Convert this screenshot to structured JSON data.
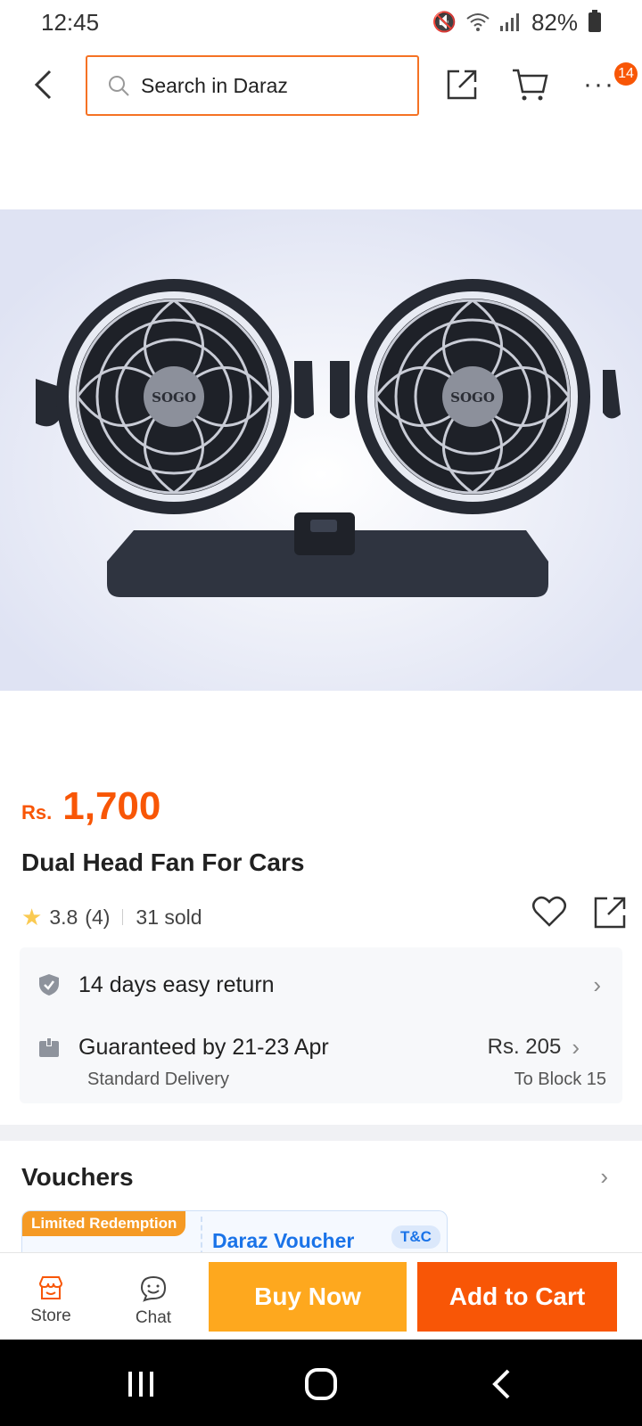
{
  "status_bar": {
    "time": "12:45",
    "battery": "82%"
  },
  "header": {
    "search_placeholder": "Search in Daraz",
    "cart_badge": "14",
    "more_label": "···"
  },
  "product": {
    "brand_on_fan": "SOGO",
    "currency": "Rs.",
    "price": "1,700",
    "title": "Dual Head Fan For Cars",
    "rating": "3.8",
    "review_count": "(4)",
    "sold": "31 sold"
  },
  "services": {
    "return_text": "14 days easy return",
    "delivery_text": "Guaranteed by 21-23 Apr",
    "delivery_type": "Standard Delivery",
    "delivery_fee": "Rs. 205",
    "delivery_location": "To Block 15"
  },
  "vouchers": {
    "title": "Vouchers",
    "tag": "Limited Redemption",
    "voucher_name": "Daraz Voucher",
    "tc_label": "T&C"
  },
  "bottom_bar": {
    "store_label": "Store",
    "chat_label": "Chat",
    "buy_now_label": "Buy Now",
    "add_to_cart_label": "Add to Cart"
  },
  "colors": {
    "accent_orange": "#f85606",
    "buy_now_yellow": "#fea81e",
    "star_yellow": "#faca51",
    "voucher_blue": "#1a73e8"
  }
}
